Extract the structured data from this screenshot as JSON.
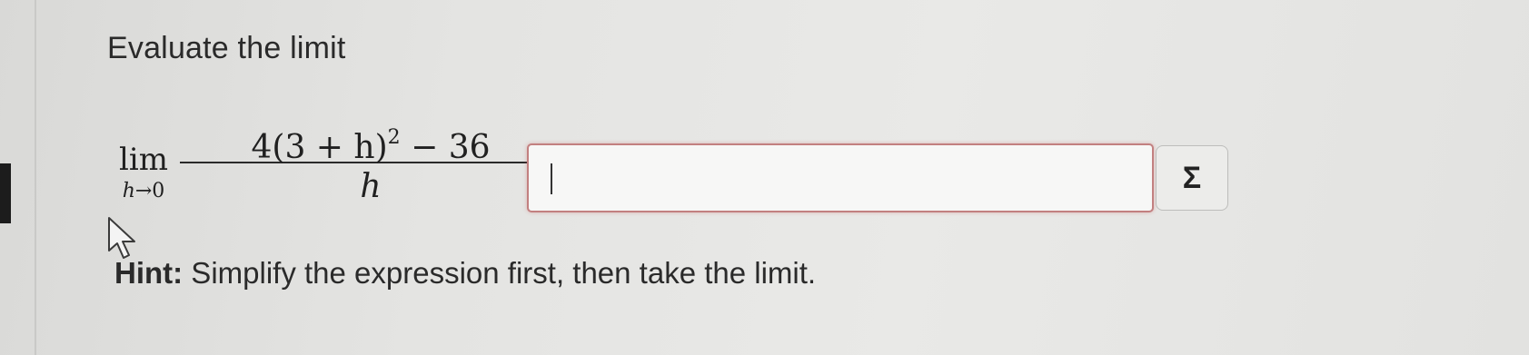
{
  "question": {
    "prompt": "Evaluate the limit",
    "math": {
      "lim": "lim",
      "sub_var": "h",
      "sub_arrow": "→0",
      "numerator_base": "4(3 + h)",
      "numerator_exp": "2",
      "numerator_rest": " − 36",
      "denominator": "h",
      "equals": "="
    },
    "answer": {
      "value": "",
      "placeholder": ""
    },
    "sigma_button_label": "Σ",
    "hint_label": "Hint:",
    "hint_text": " Simplify the expression first, then take the limit."
  },
  "icons": {
    "cursor": "mouse-pointer-icon"
  },
  "colors": {
    "input_border": "#c28080",
    "background": "#e4e4e2"
  }
}
